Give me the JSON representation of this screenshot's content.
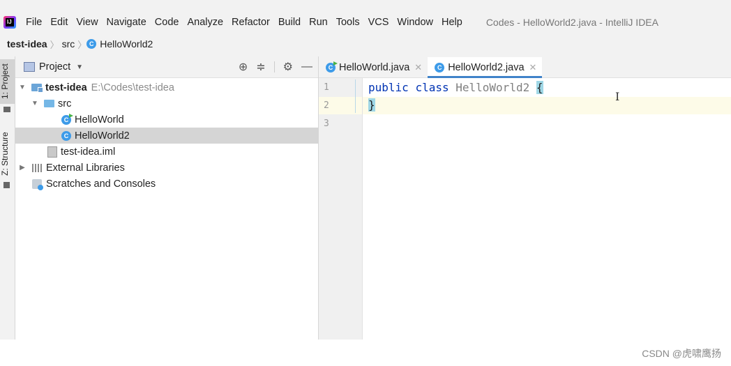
{
  "menu": {
    "items": [
      "File",
      "Edit",
      "View",
      "Navigate",
      "Code",
      "Analyze",
      "Refactor",
      "Build",
      "Run",
      "Tools",
      "VCS",
      "Window",
      "Help"
    ],
    "window_title": "Codes - HelloWorld2.java - IntelliJ IDEA"
  },
  "breadcrumb": {
    "root": "test-idea",
    "folder": "src",
    "file": "HelloWorld2"
  },
  "toolstrip": {
    "project_tab": "1: Project",
    "structure_tab": "Z: Structure"
  },
  "project_panel": {
    "title": "Project",
    "tree": {
      "root_name": "test-idea",
      "root_path": "E:\\Codes\\test-idea",
      "src": "src",
      "file1": "HelloWorld",
      "file2": "HelloWorld2",
      "iml": "test-idea.iml",
      "external": "External Libraries",
      "scratches": "Scratches and Consoles"
    }
  },
  "editor": {
    "tabs": [
      "HelloWorld.java",
      "HelloWorld2.java"
    ],
    "active_tab": "HelloWorld2.java",
    "line_numbers": [
      "1",
      "2",
      "3"
    ],
    "code": {
      "kw1": "public",
      "kw2": "class",
      "name": "HelloWorld2",
      "open": "{",
      "close": "}"
    }
  },
  "icons": [
    "app-logo-icon",
    "class-icon",
    "folder-icon",
    "module-folder-icon",
    "iml-file-icon",
    "library-icon",
    "scratch-icon",
    "target-icon",
    "collapse-icon",
    "gear-icon",
    "minimize-icon",
    "close-icon",
    "text-cursor-icon"
  ],
  "colors": {
    "keyword": "#0033b3",
    "class_name": "#808080",
    "active_tab_underline": "#4083c9",
    "selection": "#d5d5d5",
    "brace_highlight": "#9fd7e6"
  },
  "watermark": "CSDN @虎啸鹰扬"
}
